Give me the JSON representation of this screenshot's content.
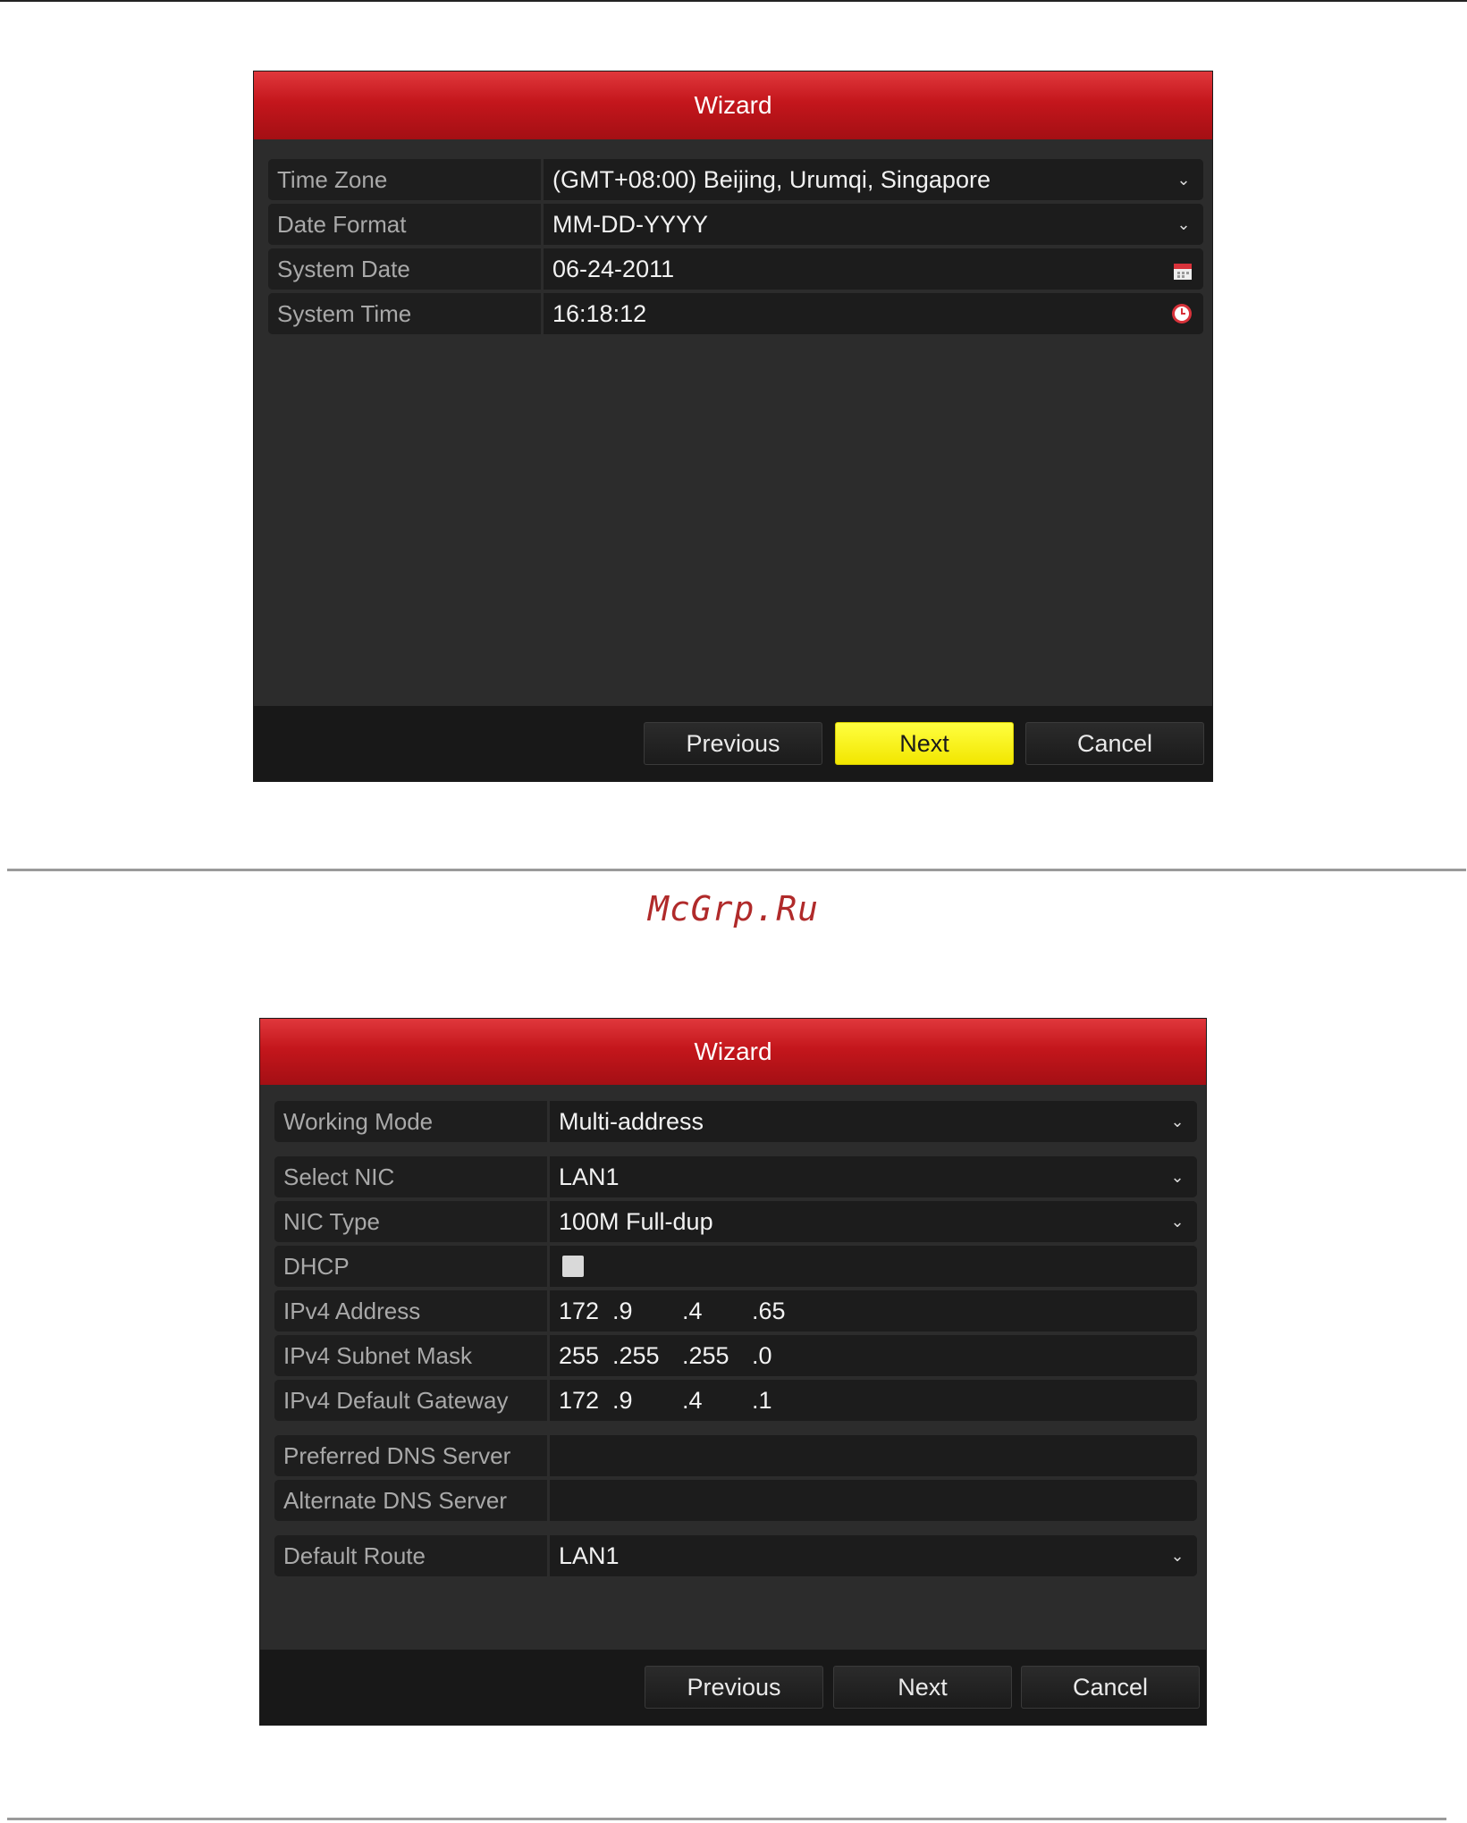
{
  "watermark": "McGrp.Ru",
  "wizard1": {
    "title": "Wizard",
    "fields": {
      "time_zone": {
        "label": "Time Zone",
        "value": "(GMT+08:00) Beijing, Urumqi, Singapore"
      },
      "date_format": {
        "label": "Date Format",
        "value": "MM-DD-YYYY"
      },
      "system_date": {
        "label": "System Date",
        "value": "06-24-2011"
      },
      "system_time": {
        "label": "System Time",
        "value": "16:18:12"
      }
    },
    "buttons": {
      "previous": "Previous",
      "next": "Next",
      "cancel": "Cancel"
    },
    "focused_button": "Next",
    "focus_color": "#f7ef00"
  },
  "wizard2": {
    "title": "Wizard",
    "fields": {
      "working_mode": {
        "label": "Working Mode",
        "value": "Multi-address"
      },
      "select_nic": {
        "label": "Select NIC",
        "value": "LAN1"
      },
      "nic_type": {
        "label": "NIC Type",
        "value": "100M Full-dup"
      },
      "dhcp": {
        "label": "DHCP",
        "checked": false
      },
      "ipv4_address": {
        "label": "IPv4 Address",
        "octets": [
          "172",
          ".9",
          ".4",
          ".65"
        ]
      },
      "ipv4_subnet_mask": {
        "label": "IPv4 Subnet Mask",
        "octets": [
          "255",
          ".255",
          ".255",
          ".0"
        ]
      },
      "ipv4_default_gateway": {
        "label": "IPv4 Default Gateway",
        "octets": [
          "172",
          ".9",
          ".4",
          ".1"
        ]
      },
      "preferred_dns": {
        "label": "Preferred DNS Server",
        "value": ""
      },
      "alternate_dns": {
        "label": "Alternate DNS Server",
        "value": ""
      },
      "default_route": {
        "label": "Default Route",
        "value": "LAN1"
      }
    },
    "buttons": {
      "previous": "Previous",
      "next": "Next",
      "cancel": "Cancel"
    }
  },
  "colors": {
    "title_red": "#c4161c",
    "panel_bg": "#2c2c2c",
    "field_bg": "#1c1c1c",
    "label_text": "#a9a9a9"
  },
  "icons": {
    "dropdown": "chevron-down-icon",
    "date": "calendar-icon",
    "time": "clock-icon"
  }
}
